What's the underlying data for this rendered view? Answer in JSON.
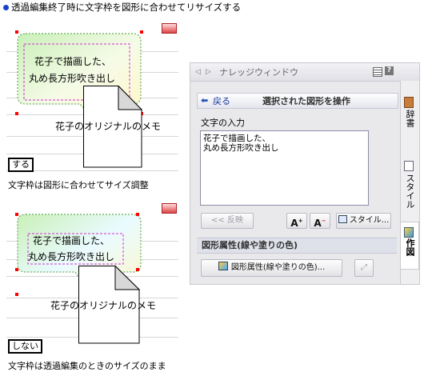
{
  "header": {
    "title": "透過編集終了時に文字枠を図形に合わせてリサイズする"
  },
  "sample_on": {
    "bubble_text": [
      "花子で描画した、",
      "丸め長方形吹き出し"
    ],
    "memo_caption": "花子のオリジナルのメモ",
    "label": "する",
    "description": "文字枠は図形に合わせてサイズ調整"
  },
  "sample_off": {
    "bubble_text": [
      "花子で描画した、",
      "丸め長方形吹き出し"
    ],
    "memo_caption": "花子のオリジナルのメモ",
    "label": "しない",
    "description": "文字枠は透過編集のときのサイズのまま"
  },
  "knowledge_window": {
    "title": "ナレッジウィンドウ",
    "back_label": "戻る",
    "panel_title": "選択された図形を操作",
    "text_input_label": "文字の入力",
    "text_value": [
      "花子で描画した、",
      "丸め長方形吹き出し"
    ],
    "reflect_button": "<< 反映",
    "style_button": "スタイル...",
    "section_title": "図形属性(線や塗りの色)",
    "attr_button": "図形属性(線や塗りの色)...",
    "tabs": [
      "辞書",
      "スタイル",
      "作図"
    ],
    "colors": {
      "header_blue": "#2a55b8",
      "panel_bg": "#e9e9ec",
      "section_bg": "#dfe1ea"
    }
  }
}
